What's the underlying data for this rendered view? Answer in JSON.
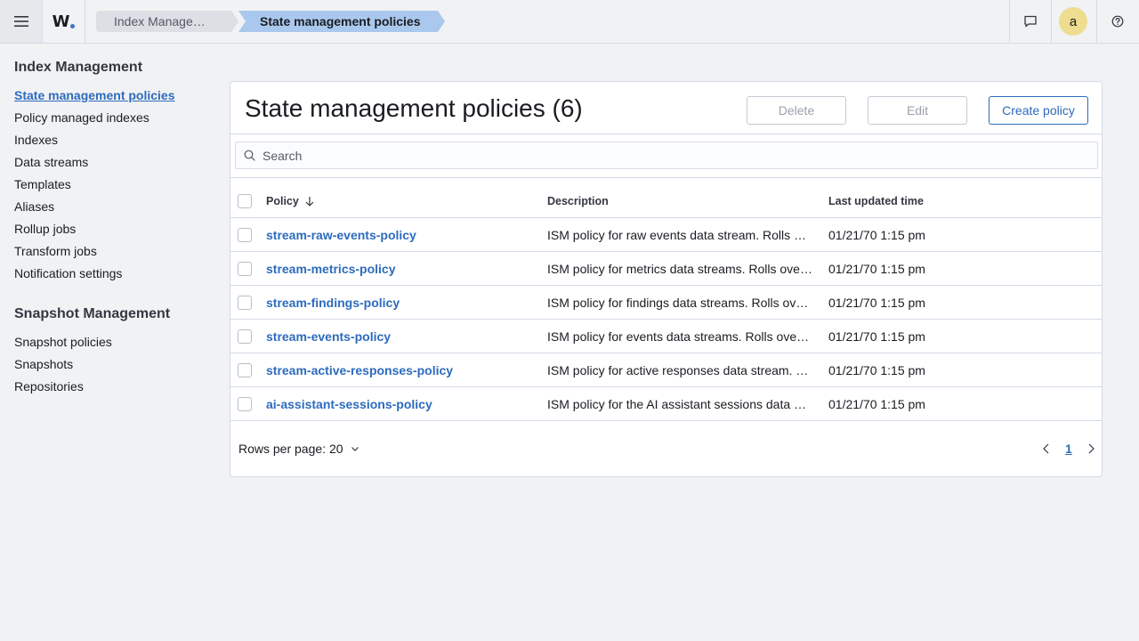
{
  "header": {
    "logo_text": "W.",
    "breadcrumbs": [
      {
        "label": "Index Management"
      },
      {
        "label": "State management policies"
      }
    ],
    "avatar_initial": "a",
    "icons": [
      "menu-icon",
      "chat-icon",
      "help-icon"
    ]
  },
  "sidebar": {
    "groups": [
      {
        "title": "Index Management",
        "items": [
          {
            "label": "State management policies",
            "active": true
          },
          {
            "label": "Policy managed indexes"
          },
          {
            "label": "Indexes"
          },
          {
            "label": "Data streams"
          },
          {
            "label": "Templates"
          },
          {
            "label": "Aliases"
          },
          {
            "label": "Rollup jobs"
          },
          {
            "label": "Transform jobs"
          },
          {
            "label": "Notification settings"
          }
        ]
      },
      {
        "title": "Snapshot Management",
        "items": [
          {
            "label": "Snapshot policies"
          },
          {
            "label": "Snapshots"
          },
          {
            "label": "Repositories"
          }
        ]
      }
    ]
  },
  "main": {
    "title": "State management policies (6)",
    "buttons": {
      "delete": "Delete",
      "edit": "Edit",
      "create": "Create policy"
    },
    "search": {
      "placeholder": "Search",
      "value": ""
    },
    "table": {
      "columns": {
        "policy": "Policy",
        "description": "Description",
        "updated": "Last updated time"
      },
      "sort": {
        "column": "policy",
        "direction": "descending"
      },
      "rows": [
        {
          "policy": "stream-raw-events-policy",
          "description": "ISM policy for raw events data stream. Rolls over…",
          "updated": "01/21/70 1:15 pm"
        },
        {
          "policy": "stream-metrics-policy",
          "description": "ISM policy for metrics data streams. Rolls over…",
          "updated": "01/21/70 1:15 pm"
        },
        {
          "policy": "stream-findings-policy",
          "description": "ISM policy for findings data streams. Rolls over…",
          "updated": "01/21/70 1:15 pm"
        },
        {
          "policy": "stream-events-policy",
          "description": "ISM policy for events data streams. Rolls over…",
          "updated": "01/21/70 1:15 pm"
        },
        {
          "policy": "stream-active-responses-policy",
          "description": "ISM policy for active responses data stream. …",
          "updated": "01/21/70 1:15 pm"
        },
        {
          "policy": "ai-assistant-sessions-policy",
          "description": "ISM policy for the AI assistant sessions data …",
          "updated": "01/21/70 1:15 pm"
        }
      ]
    },
    "pagination": {
      "rows_per_page_label": "Rows per page: 20",
      "current_page": "1"
    }
  },
  "colors": {
    "accent": "#2d6bbd",
    "breadcrumb_active": "#aac8ee",
    "avatar": "#eedc90",
    "background": "#f1f2f4"
  }
}
